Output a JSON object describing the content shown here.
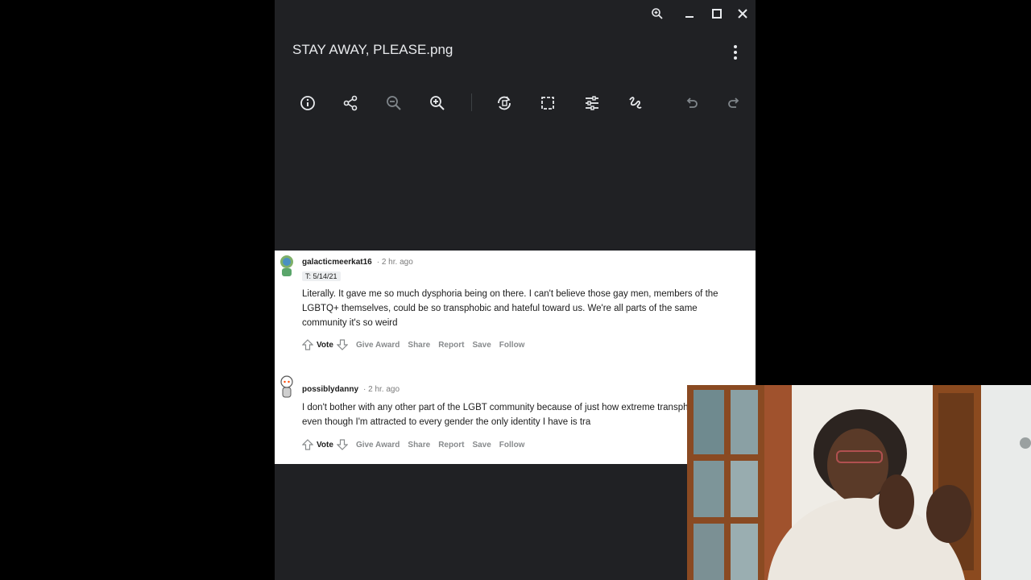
{
  "viewer": {
    "filename": "STAY AWAY, PLEASE.png",
    "window_controls": [
      "zoom-icon",
      "minimize-icon",
      "maximize-icon",
      "close-icon"
    ],
    "toolbar": [
      "info-icon",
      "share-icon",
      "zoom-out-icon",
      "zoom-in-icon",
      "rotate-icon",
      "crop-icon",
      "adjust-icon",
      "markup-icon",
      "undo-icon",
      "redo-icon"
    ]
  },
  "comments": [
    {
      "username": "galacticmeerkat16",
      "time": "· 2 hr. ago",
      "flair": "T: 5/14/21",
      "body": "Literally. It gave me so much dysphoria being on there. I can't believe those gay men, members of the LGBTQ+ themselves, could be so transphobic and hateful toward us. We're all parts of the same community it's so weird",
      "actions": {
        "vote": "Vote",
        "award": "Give Award",
        "share": "Share",
        "report": "Report",
        "save": "Save",
        "follow": "Follow"
      }
    },
    {
      "username": "possiblydanny",
      "time": "· 2 hr. ago",
      "body": "I don't bother with any other part of the LGBT community because of just how extreme transphobia is, even though I'm attracted to every gender the only identity I have is tra",
      "actions": {
        "vote": "Vote",
        "award": "Give Award",
        "share": "Share",
        "report": "Report",
        "save": "Save",
        "follow": "Follow"
      }
    }
  ],
  "colors": {
    "viewer_bg": "#202124",
    "icon": "#e8eaed",
    "disabled_icon": "#80868b"
  }
}
